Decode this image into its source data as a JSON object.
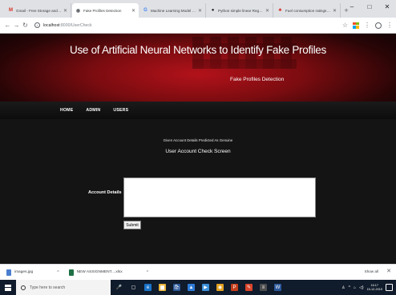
{
  "browser": {
    "tabs": [
      {
        "title": "Gmail - Free Storage and Emai",
        "icon": "gmail-icon",
        "glyph": "M",
        "color": "#d93025",
        "active": false
      },
      {
        "title": "Fake Profiles Detection",
        "icon": "chrome-icon",
        "glyph": "◉",
        "color": "#5f6368",
        "active": true
      },
      {
        "title": "Machine Learning Model for C",
        "icon": "google-icon",
        "glyph": "G",
        "color": "#4285f4",
        "active": false
      },
      {
        "title": "Python simple linear Regress",
        "icon": "github-icon",
        "glyph": "●",
        "color": "#202124",
        "active": false
      },
      {
        "title": "Fuel consumption ratings - Ca",
        "icon": "canada-flag-icon",
        "glyph": "♣",
        "color": "#d52b1e",
        "active": false
      }
    ],
    "new_tab": "+",
    "window_controls": {
      "minimize": "–",
      "maximize": "□",
      "close": "✕"
    },
    "address": {
      "host": "localhost",
      "path": ":8000/UserCheck"
    }
  },
  "page": {
    "title": "Use of Artificial Neural Networks to Identify Fake Profiles",
    "subtitle": "Fake Profiles Detection",
    "nav": [
      "HOME",
      "ADMIN",
      "USERS"
    ],
    "message": "Given Account Details Predicted As Genuine",
    "screen_title": "User Account Check Screen",
    "field_label": "Account Details",
    "textarea_value": "",
    "submit_label": "Submit"
  },
  "downloads": {
    "items": [
      {
        "name": "images.jpg",
        "color": "#4a7fd0"
      },
      {
        "name": "NEW ASSIGNMENT....xlsx",
        "color": "#1e7145"
      }
    ],
    "show_all": "Show all",
    "close": "✕"
  },
  "taskbar": {
    "search_placeholder": "Type here to search",
    "apps": [
      {
        "icon": "microphone-icon",
        "glyph": "🎤",
        "color": "transparent"
      },
      {
        "icon": "task-view-icon",
        "glyph": "▢",
        "color": "transparent"
      },
      {
        "icon": "edge-icon",
        "glyph": "e",
        "color": "#1a73c8"
      },
      {
        "icon": "file-explorer-icon",
        "glyph": "▆",
        "color": "#e8b43a"
      },
      {
        "icon": "store-icon",
        "glyph": "🛍",
        "color": "#2b5797"
      },
      {
        "icon": "photos-icon",
        "glyph": "▲",
        "color": "#2e7bd6"
      },
      {
        "icon": "media-icon",
        "glyph": "▶",
        "color": "#3a8fd8"
      },
      {
        "icon": "chrome-taskbar-icon",
        "glyph": "◉",
        "color": "#e0a020"
      },
      {
        "icon": "powerpoint-icon",
        "glyph": "P",
        "color": "#c43e1c"
      },
      {
        "icon": "paint-icon",
        "glyph": "✎",
        "color": "#d9442b"
      },
      {
        "icon": "notepad-icon",
        "glyph": "≡",
        "color": "#4d4d4d"
      },
      {
        "icon": "word-icon",
        "glyph": "W",
        "color": "#2b579a"
      }
    ],
    "time": "16:17",
    "date": "15-12-2019"
  }
}
